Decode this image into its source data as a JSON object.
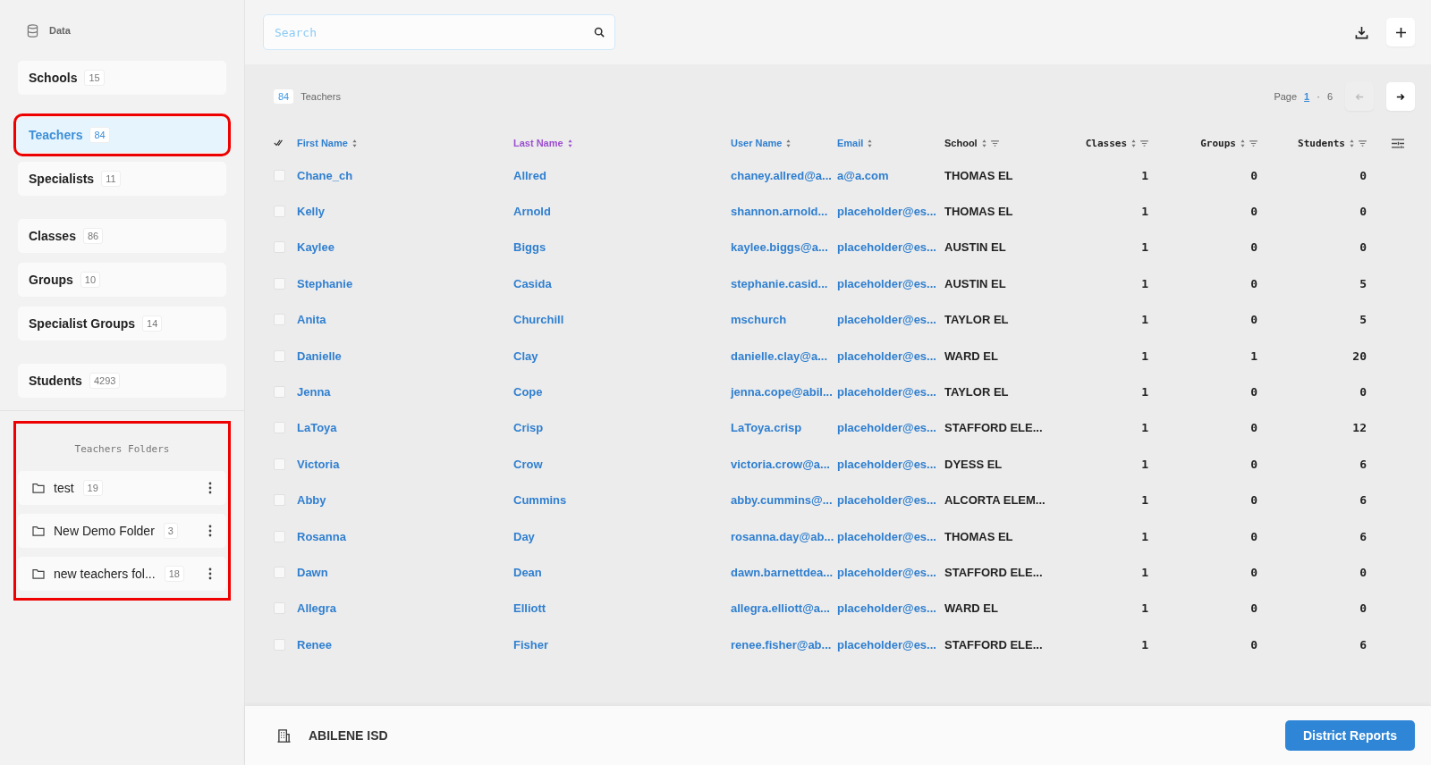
{
  "sidebar": {
    "title": "Data",
    "groups": [
      [
        {
          "label": "Schools",
          "count": "15",
          "selected": false,
          "highlighted": false
        }
      ],
      [
        {
          "label": "Teachers",
          "count": "84",
          "selected": true,
          "highlighted": true
        },
        {
          "label": "Specialists",
          "count": "11",
          "selected": false,
          "highlighted": false
        }
      ],
      [
        {
          "label": "Classes",
          "count": "86",
          "selected": false,
          "highlighted": false
        },
        {
          "label": "Groups",
          "count": "10",
          "selected": false,
          "highlighted": false
        },
        {
          "label": "Specialist Groups",
          "count": "14",
          "selected": false,
          "highlighted": false
        }
      ],
      [
        {
          "label": "Students",
          "count": "4293",
          "selected": false,
          "highlighted": false
        }
      ]
    ],
    "folders": {
      "title": "Teachers Folders",
      "highlighted": true,
      "items": [
        {
          "label": "test",
          "count": "19"
        },
        {
          "label": "New Demo Folder",
          "count": "3"
        },
        {
          "label": "new teachers fol...",
          "count": "18"
        }
      ]
    }
  },
  "search": {
    "placeholder": "Search"
  },
  "summary": {
    "count": "84",
    "label": "Teachers"
  },
  "pagination": {
    "label": "Page",
    "current": "1",
    "separator": "·",
    "total": "6"
  },
  "table": {
    "columns": [
      {
        "label": "First Name",
        "kind": "text",
        "filter": false,
        "selected": false
      },
      {
        "label": "Last Name",
        "kind": "text",
        "filter": false,
        "selected": true
      },
      {
        "label": "User Name",
        "kind": "text",
        "filter": false,
        "selected": false
      },
      {
        "label": "Email",
        "kind": "text",
        "filter": false,
        "selected": false
      },
      {
        "label": "School",
        "kind": "plain",
        "filter": true,
        "selected": false
      },
      {
        "label": "Classes",
        "kind": "number",
        "filter": true,
        "selected": false
      },
      {
        "label": "Groups",
        "kind": "number",
        "filter": true,
        "selected": false
      },
      {
        "label": "Students",
        "kind": "number",
        "filter": true,
        "selected": false
      }
    ],
    "rows": [
      {
        "checked": false,
        "cells": [
          "Chane_ch",
          "Allred",
          "chaney.allred@a...",
          "a@a.com",
          "THOMAS EL",
          "1",
          "0",
          "0"
        ]
      },
      {
        "checked": false,
        "cells": [
          "Kelly",
          "Arnold",
          "shannon.arnold...",
          "placeholder@es...",
          "THOMAS EL",
          "1",
          "0",
          "0"
        ]
      },
      {
        "checked": false,
        "cells": [
          "Kaylee",
          "Biggs",
          "kaylee.biggs@a...",
          "placeholder@es...",
          "AUSTIN EL",
          "1",
          "0",
          "0"
        ]
      },
      {
        "checked": false,
        "cells": [
          "Stephanie",
          "Casida",
          "stephanie.casid...",
          "placeholder@es...",
          "AUSTIN EL",
          "1",
          "0",
          "5"
        ]
      },
      {
        "checked": false,
        "cells": [
          "Anita",
          "Churchill",
          "mschurch",
          "placeholder@es...",
          "TAYLOR EL",
          "1",
          "0",
          "5"
        ]
      },
      {
        "checked": false,
        "cells": [
          "Danielle",
          "Clay",
          "danielle.clay@a...",
          "placeholder@es...",
          "WARD EL",
          "1",
          "1",
          "20"
        ]
      },
      {
        "checked": false,
        "cells": [
          "Jenna",
          "Cope",
          "jenna.cope@abil...",
          "placeholder@es...",
          "TAYLOR EL",
          "1",
          "0",
          "0"
        ]
      },
      {
        "checked": false,
        "cells": [
          "LaToya",
          "Crisp",
          "LaToya.crisp",
          "placeholder@es...",
          "STAFFORD ELE...",
          "1",
          "0",
          "12"
        ]
      },
      {
        "checked": false,
        "cells": [
          "Victoria",
          "Crow",
          "victoria.crow@a...",
          "placeholder@es...",
          "DYESS EL",
          "1",
          "0",
          "6"
        ]
      },
      {
        "checked": false,
        "cells": [
          "Abby",
          "Cummins",
          "abby.cummins@...",
          "placeholder@es...",
          "ALCORTA ELEM...",
          "1",
          "0",
          "6"
        ]
      },
      {
        "checked": false,
        "cells": [
          "Rosanna",
          "Day",
          "rosanna.day@ab...",
          "placeholder@es...",
          "THOMAS EL",
          "1",
          "0",
          "6"
        ]
      },
      {
        "checked": false,
        "cells": [
          "Dawn",
          "Dean",
          "dawn.barnettdea...",
          "placeholder@es...",
          "STAFFORD ELE...",
          "1",
          "0",
          "0"
        ]
      },
      {
        "checked": false,
        "cells": [
          "Allegra",
          "Elliott",
          "allegra.elliott@a...",
          "placeholder@es...",
          "WARD EL",
          "1",
          "0",
          "0"
        ]
      },
      {
        "checked": false,
        "cells": [
          "Renee",
          "Fisher",
          "renee.fisher@ab...",
          "placeholder@es...",
          "STAFFORD ELE...",
          "1",
          "0",
          "6"
        ]
      }
    ]
  },
  "footer": {
    "district": "ABILENE ISD",
    "button": "District Reports"
  }
}
